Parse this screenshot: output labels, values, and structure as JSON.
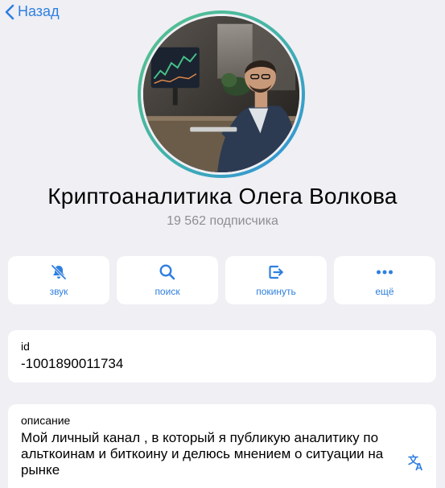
{
  "nav": {
    "back_label": "Назад"
  },
  "profile": {
    "name": "Криптоаналитика Олега Волкова",
    "subscribers": "19 562 подписчика"
  },
  "actions": [
    {
      "label": "звук",
      "icon": "bell-slash-icon"
    },
    {
      "label": "поиск",
      "icon": "search-icon"
    },
    {
      "label": "покинуть",
      "icon": "leave-icon"
    },
    {
      "label": "ещё",
      "icon": "more-icon"
    }
  ],
  "info": {
    "id_caption": "id",
    "id_value": "-1001890011734",
    "desc_caption": "описание",
    "desc_value": "Мой личный канал , в который я публикую аналитику по альткоинам и биткоину и делюсь мнением о ситуации на рынке"
  },
  "colors": {
    "accent": "#2f7fe0",
    "background": "#efeff4",
    "secondary_text": "#8e8e93"
  }
}
